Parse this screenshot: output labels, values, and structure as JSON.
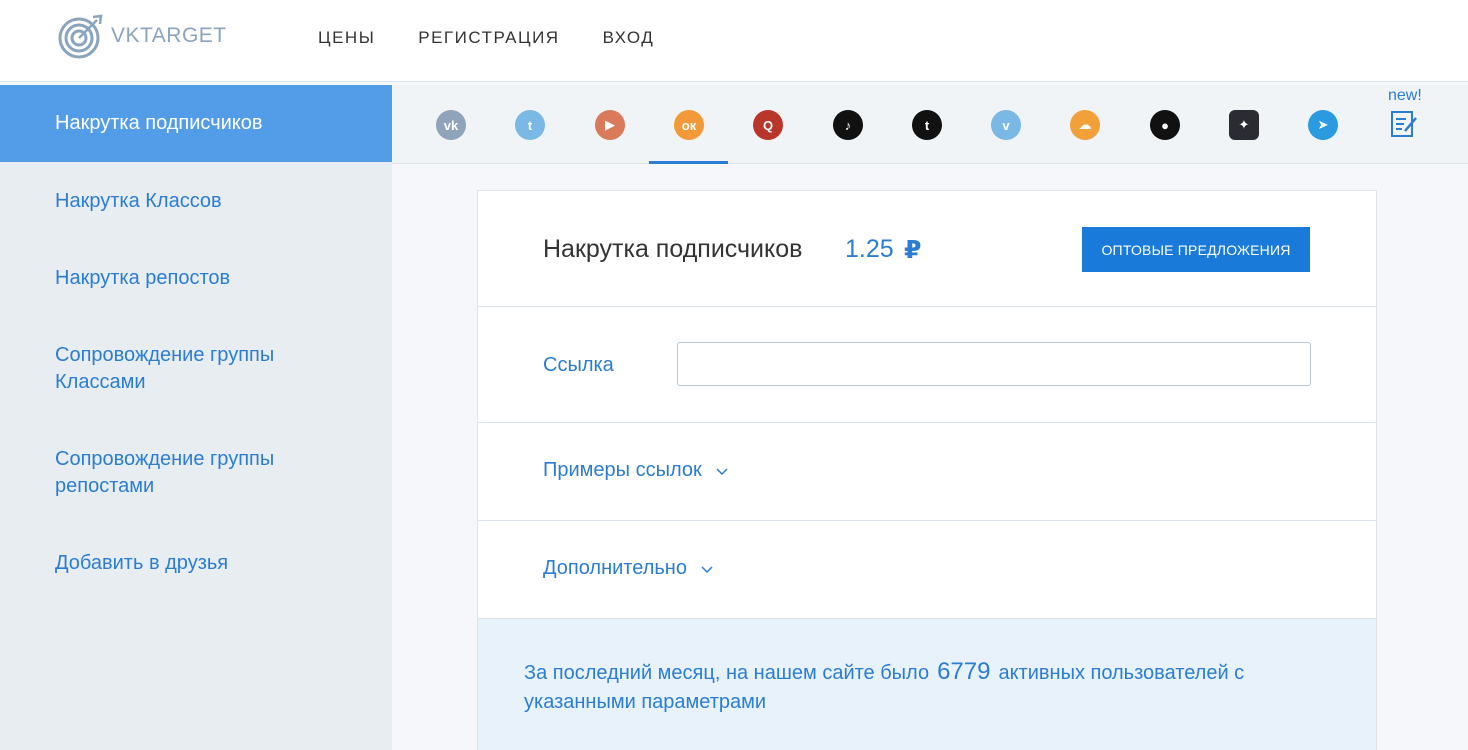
{
  "header": {
    "logo_text": "VKTARGET",
    "nav": [
      "ЦЕНЫ",
      "РЕГИСТРАЦИЯ",
      "ВХОД"
    ]
  },
  "sidebar": {
    "active": "Накрутка подписчиков",
    "items": [
      "Накрутка Классов",
      "Накрутка репостов",
      "Сопровождение группы Классами",
      "Сопровождение группы репостами",
      "Добавить в друзья"
    ]
  },
  "social": {
    "new_label": "new!",
    "icons": [
      {
        "name": "vk-icon",
        "color": "#8fa3ba",
        "glyph": "vk"
      },
      {
        "name": "twitter-icon",
        "color": "#7ab8e6",
        "glyph": "t"
      },
      {
        "name": "youtube-icon",
        "color": "#d97a5a",
        "glyph": "▶"
      },
      {
        "name": "odnoklassniki-icon",
        "color": "#f29a3a",
        "glyph": "ок"
      },
      {
        "name": "quora-icon",
        "color": "#b8372a",
        "glyph": "Q"
      },
      {
        "name": "tiktok-icon",
        "color": "#111111",
        "glyph": "♪"
      },
      {
        "name": "tumblr-icon",
        "color": "#111111",
        "glyph": "t"
      },
      {
        "name": "vimeo-icon",
        "color": "#7ab8e6",
        "glyph": "v"
      },
      {
        "name": "soundcloud-icon",
        "color": "#f2a03a",
        "glyph": "☁"
      },
      {
        "name": "reddit-icon",
        "color": "#111111",
        "glyph": "●"
      },
      {
        "name": "zen-icon",
        "color": "#2b2b33",
        "glyph": "✦"
      },
      {
        "name": "telegram-icon",
        "color": "#2a9be0",
        "glyph": "➤"
      }
    ]
  },
  "main": {
    "title": "Накрутка подписчиков",
    "price": "1.25",
    "currency": "₽",
    "wholesale_button": "ОПТОВЫЕ ПРЕДЛОЖЕНИЯ",
    "link_label": "Ссылка",
    "link_value": "",
    "examples_label": "Примеры ссылок",
    "additional_label": "Дополнительно",
    "info_before": "За последний месяц, на нашем сайте было",
    "info_count": "6779",
    "info_after": "активных пользователей с указанными параметрами"
  }
}
